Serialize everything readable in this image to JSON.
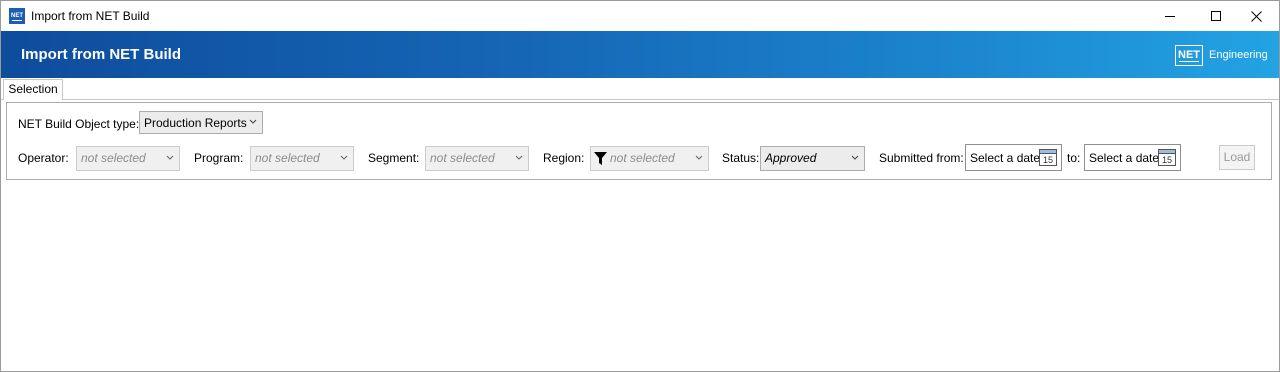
{
  "window": {
    "title": "Import from NET Build",
    "icon_text": "NET"
  },
  "banner": {
    "title": "Import from NET Build",
    "brand_box": "NET",
    "brand_text": "Engineering"
  },
  "tabs": [
    {
      "label": "Selection",
      "active": true
    }
  ],
  "filters": {
    "object_type": {
      "label": "NET Build Object type:",
      "value": "Production Reports"
    },
    "operator": {
      "label": "Operator:",
      "value": "not selected"
    },
    "program": {
      "label": "Program:",
      "value": "not selected"
    },
    "segment": {
      "label": "Segment:",
      "value": "not selected"
    },
    "region": {
      "label": "Region:",
      "value": "not selected"
    },
    "status": {
      "label": "Status:",
      "value": "Approved"
    },
    "submitted_from": {
      "label": "Submitted from:",
      "value": "Select a date",
      "calendar_day": "15"
    },
    "submitted_to": {
      "label": "to:",
      "value": "Select a date",
      "calendar_day": "15"
    },
    "load_label": "Load"
  },
  "colors": {
    "banner_start": "#0e4c9c",
    "banner_end": "#23a3e3",
    "accent": "#1a5fb4"
  }
}
